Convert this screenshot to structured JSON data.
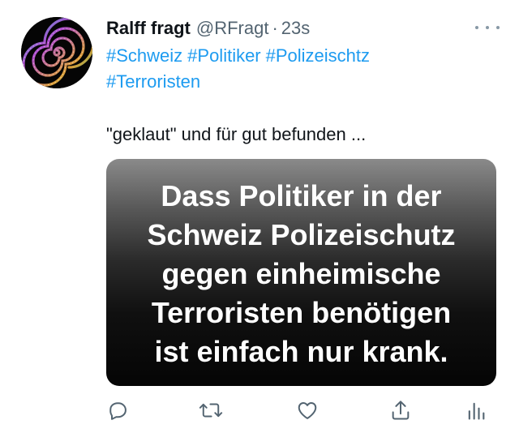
{
  "tweet": {
    "display_name": "Ralff fragt",
    "handle": "@RFragt",
    "separator": "·",
    "time": "23s",
    "hashtags": [
      "#Schweiz",
      "#Politiker",
      "#Polizeischtz",
      "#Terroristen"
    ],
    "text": "\"geklaut\" und für gut befunden ...",
    "image_text": "Dass Politiker in der\nSchweiz Polizeischutz\ngegen einheimische\nTerroristen benötigen\nist einfach nur krank."
  },
  "icons": {
    "avatar": "spiral-avatar",
    "more": "more-dots-icon",
    "reply": "reply-icon",
    "retweet": "retweet-icon",
    "like": "heart-icon",
    "share": "share-icon",
    "analytics": "analytics-icon"
  },
  "colors": {
    "link": "#1d9bf0",
    "secondary_text": "#536471",
    "icon": "#536471",
    "primary_text": "#0f1419"
  }
}
